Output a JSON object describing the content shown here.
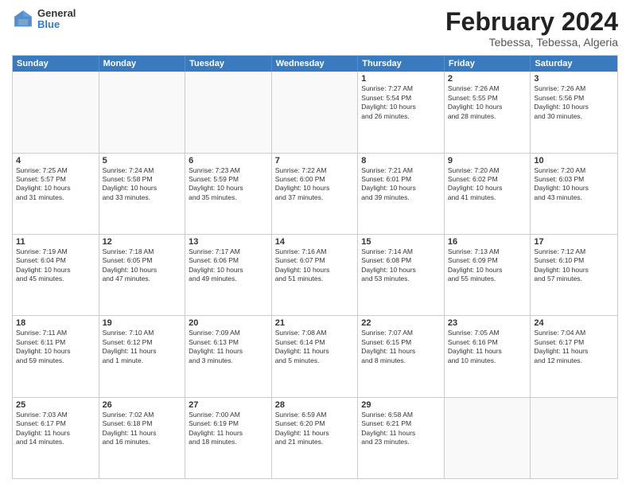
{
  "logo": {
    "general": "General",
    "blue": "Blue"
  },
  "title": "February 2024",
  "subtitle": "Tebessa, Tebessa, Algeria",
  "header_days": [
    "Sunday",
    "Monday",
    "Tuesday",
    "Wednesday",
    "Thursday",
    "Friday",
    "Saturday"
  ],
  "weeks": [
    [
      {
        "day": "",
        "info": "",
        "empty": true
      },
      {
        "day": "",
        "info": "",
        "empty": true
      },
      {
        "day": "",
        "info": "",
        "empty": true
      },
      {
        "day": "",
        "info": "",
        "empty": true
      },
      {
        "day": "1",
        "info": "Sunrise: 7:27 AM\nSunset: 5:54 PM\nDaylight: 10 hours\nand 26 minutes."
      },
      {
        "day": "2",
        "info": "Sunrise: 7:26 AM\nSunset: 5:55 PM\nDaylight: 10 hours\nand 28 minutes."
      },
      {
        "day": "3",
        "info": "Sunrise: 7:26 AM\nSunset: 5:56 PM\nDaylight: 10 hours\nand 30 minutes."
      }
    ],
    [
      {
        "day": "4",
        "info": "Sunrise: 7:25 AM\nSunset: 5:57 PM\nDaylight: 10 hours\nand 31 minutes."
      },
      {
        "day": "5",
        "info": "Sunrise: 7:24 AM\nSunset: 5:58 PM\nDaylight: 10 hours\nand 33 minutes."
      },
      {
        "day": "6",
        "info": "Sunrise: 7:23 AM\nSunset: 5:59 PM\nDaylight: 10 hours\nand 35 minutes."
      },
      {
        "day": "7",
        "info": "Sunrise: 7:22 AM\nSunset: 6:00 PM\nDaylight: 10 hours\nand 37 minutes."
      },
      {
        "day": "8",
        "info": "Sunrise: 7:21 AM\nSunset: 6:01 PM\nDaylight: 10 hours\nand 39 minutes."
      },
      {
        "day": "9",
        "info": "Sunrise: 7:20 AM\nSunset: 6:02 PM\nDaylight: 10 hours\nand 41 minutes."
      },
      {
        "day": "10",
        "info": "Sunrise: 7:20 AM\nSunset: 6:03 PM\nDaylight: 10 hours\nand 43 minutes."
      }
    ],
    [
      {
        "day": "11",
        "info": "Sunrise: 7:19 AM\nSunset: 6:04 PM\nDaylight: 10 hours\nand 45 minutes."
      },
      {
        "day": "12",
        "info": "Sunrise: 7:18 AM\nSunset: 6:05 PM\nDaylight: 10 hours\nand 47 minutes."
      },
      {
        "day": "13",
        "info": "Sunrise: 7:17 AM\nSunset: 6:06 PM\nDaylight: 10 hours\nand 49 minutes."
      },
      {
        "day": "14",
        "info": "Sunrise: 7:16 AM\nSunset: 6:07 PM\nDaylight: 10 hours\nand 51 minutes."
      },
      {
        "day": "15",
        "info": "Sunrise: 7:14 AM\nSunset: 6:08 PM\nDaylight: 10 hours\nand 53 minutes."
      },
      {
        "day": "16",
        "info": "Sunrise: 7:13 AM\nSunset: 6:09 PM\nDaylight: 10 hours\nand 55 minutes."
      },
      {
        "day": "17",
        "info": "Sunrise: 7:12 AM\nSunset: 6:10 PM\nDaylight: 10 hours\nand 57 minutes."
      }
    ],
    [
      {
        "day": "18",
        "info": "Sunrise: 7:11 AM\nSunset: 6:11 PM\nDaylight: 10 hours\nand 59 minutes."
      },
      {
        "day": "19",
        "info": "Sunrise: 7:10 AM\nSunset: 6:12 PM\nDaylight: 11 hours\nand 1 minute."
      },
      {
        "day": "20",
        "info": "Sunrise: 7:09 AM\nSunset: 6:13 PM\nDaylight: 11 hours\nand 3 minutes."
      },
      {
        "day": "21",
        "info": "Sunrise: 7:08 AM\nSunset: 6:14 PM\nDaylight: 11 hours\nand 5 minutes."
      },
      {
        "day": "22",
        "info": "Sunrise: 7:07 AM\nSunset: 6:15 PM\nDaylight: 11 hours\nand 8 minutes."
      },
      {
        "day": "23",
        "info": "Sunrise: 7:05 AM\nSunset: 6:16 PM\nDaylight: 11 hours\nand 10 minutes."
      },
      {
        "day": "24",
        "info": "Sunrise: 7:04 AM\nSunset: 6:17 PM\nDaylight: 11 hours\nand 12 minutes."
      }
    ],
    [
      {
        "day": "25",
        "info": "Sunrise: 7:03 AM\nSunset: 6:17 PM\nDaylight: 11 hours\nand 14 minutes."
      },
      {
        "day": "26",
        "info": "Sunrise: 7:02 AM\nSunset: 6:18 PM\nDaylight: 11 hours\nand 16 minutes."
      },
      {
        "day": "27",
        "info": "Sunrise: 7:00 AM\nSunset: 6:19 PM\nDaylight: 11 hours\nand 18 minutes."
      },
      {
        "day": "28",
        "info": "Sunrise: 6:59 AM\nSunset: 6:20 PM\nDaylight: 11 hours\nand 21 minutes."
      },
      {
        "day": "29",
        "info": "Sunrise: 6:58 AM\nSunset: 6:21 PM\nDaylight: 11 hours\nand 23 minutes."
      },
      {
        "day": "",
        "info": "",
        "empty": true
      },
      {
        "day": "",
        "info": "",
        "empty": true
      }
    ]
  ]
}
